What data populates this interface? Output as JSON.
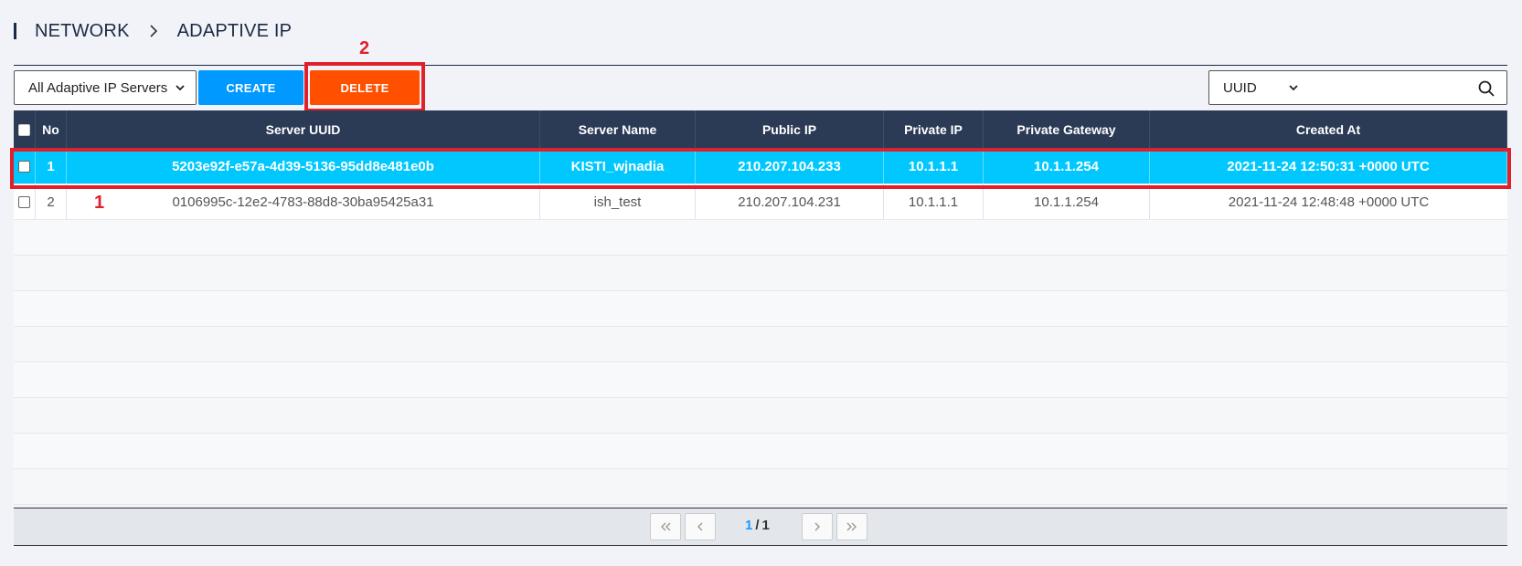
{
  "breadcrumb": {
    "section": "NETWORK",
    "page": "ADAPTIVE IP"
  },
  "toolbar": {
    "filter_value": "All Adaptive IP Servers",
    "create_label": "CREATE",
    "delete_label": "DELETE"
  },
  "search": {
    "type_value": "UUID",
    "placeholder": ""
  },
  "callouts": {
    "row_marker": "1",
    "delete_marker": "2"
  },
  "table": {
    "columns": [
      "No",
      "Server UUID",
      "Server Name",
      "Public IP",
      "Private IP",
      "Private Gateway",
      "Created At"
    ],
    "rows": [
      {
        "no": "1",
        "uuid": "5203e92f-e57a-4d39-5136-95dd8e481e0b",
        "name": "KISTI_wjnadia",
        "public_ip": "210.207.104.233",
        "private_ip": "10.1.1.1",
        "gateway": "10.1.1.254",
        "created": "2021-11-24 12:50:31 +0000 UTC",
        "selected": true
      },
      {
        "no": "2",
        "uuid": "0106995c-12e2-4783-88d8-30ba95425a31",
        "name": "ish_test",
        "public_ip": "210.207.104.231",
        "private_ip": "10.1.1.1",
        "gateway": "10.1.1.254",
        "created": "2021-11-24 12:48:48 +0000 UTC",
        "selected": false
      }
    ]
  },
  "pagination": {
    "current": "1",
    "separator": "/",
    "total": "1"
  },
  "colors": {
    "header_bg": "#2b3a55",
    "selected_row": "#00c8ff",
    "create_button": "#0099ff",
    "delete_button": "#ff5000",
    "callout": "#e0202a"
  }
}
